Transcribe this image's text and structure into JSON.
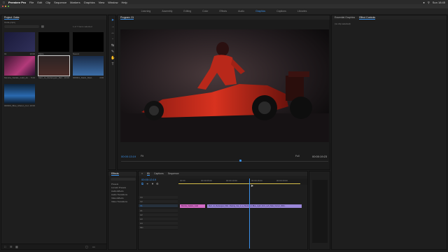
{
  "menubar": {
    "app": "Premiere Pro",
    "items": [
      "File",
      "Edit",
      "Clip",
      "Sequence",
      "Markers",
      "Graphics",
      "View",
      "Window",
      "Help"
    ],
    "clock": "Sun 18:45"
  },
  "workspaces": {
    "items": [
      "Learning",
      "Assembly",
      "Editing",
      "Color",
      "Effects",
      "Audio",
      "Graphics",
      "Captions",
      "Libraries"
    ],
    "active_index": 6
  },
  "project": {
    "title": "Project: Outta",
    "bin": "Outta.prproj",
    "items_count": "1 of 7 items selected",
    "clips": [
      {
        "name": "01",
        "duration": "10:00"
      },
      {
        "name": "Matte",
        "duration": ""
      },
      {
        "name": "Sound",
        "duration": ""
      },
      {
        "name": "Monica_Nadalo_Gold_Ac...",
        "duration": "5:24"
      },
      {
        "name": "Merl_Jo_Redenguer_Bicl...",
        "duration": "10:06"
      },
      {
        "name": "000001_Stack_Mad...",
        "duration": "4:06"
      },
      {
        "name": "000003_Blue_Motion_Col...",
        "duration": "10:00"
      }
    ]
  },
  "program": {
    "title": "Program: 01",
    "timecode_left": "00:00:13:19",
    "fit": "Fit",
    "quality": "Full",
    "timecode_right": "00:00:19:23"
  },
  "essential": {
    "tabs": [
      "Essential Graphics",
      "Effect Controls"
    ],
    "active_tab": 1,
    "no_clip": "(no clip selected)"
  },
  "effects": {
    "title": "Effects",
    "items": [
      "Presets",
      "Lumetri Presets",
      "Audio Effects",
      "Audio Transitions",
      "Video Effects",
      "Video Transitions"
    ]
  },
  "timeline": {
    "tabs": [
      "01",
      "Captions",
      "Sequence"
    ],
    "timecode": "00:00:13:19",
    "ruler": [
      "00:00",
      "00:00:05:00",
      "00:00:10:00",
      "00:00:15:00",
      "00:00:20:00"
    ],
    "tracks": [
      "V3",
      "V2",
      "V1",
      "A1",
      "A2",
      "A3",
      "A4",
      "Mix"
    ],
    "clips": [
      {
        "name": "Monica_Nadalo_Gold",
        "track": "V1",
        "color": "#d36bc5"
      },
      {
        "name": "Merl_Jo_Redenguer_Bicl...Racing_Car_in_a_Studio_of_Blue_Light_from_Left_Side_Corner_Whit...",
        "track": "V1",
        "color": "#9a86d8"
      }
    ]
  },
  "colors": {
    "accent": "#3b90e8",
    "clip_pink": "#d36bc5",
    "clip_purple": "#9a86d8"
  }
}
